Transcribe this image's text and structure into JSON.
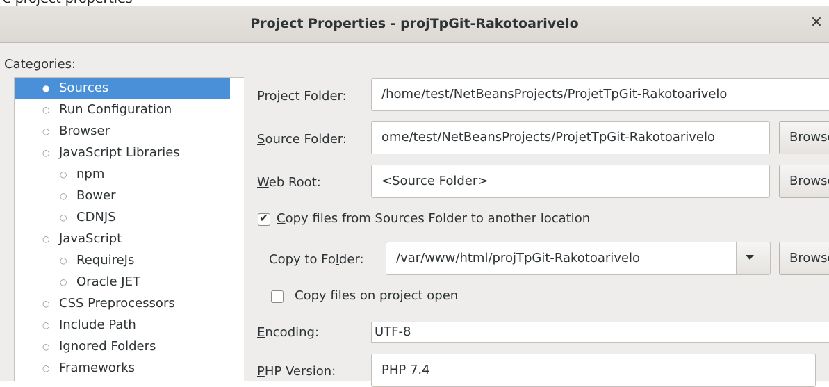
{
  "window": {
    "top_strip_text": "e project properties",
    "title": "Project Properties - projTpGit-Rakotoarivelo",
    "close_glyph": "×"
  },
  "categories": {
    "label_mnemonic": "C",
    "label_rest": "ategories:",
    "items": [
      {
        "label": "Sources",
        "level": 1,
        "selected": true,
        "expander": ""
      },
      {
        "label": "Run Configuration",
        "level": 1,
        "selected": false,
        "expander": ""
      },
      {
        "label": "Browser",
        "level": 1,
        "selected": false,
        "expander": ""
      },
      {
        "label": "JavaScript Libraries",
        "level": 1,
        "selected": false,
        "expander": "▼"
      },
      {
        "label": "npm",
        "level": 2,
        "selected": false,
        "expander": ""
      },
      {
        "label": "Bower",
        "level": 2,
        "selected": false,
        "expander": ""
      },
      {
        "label": "CDNJS",
        "level": 2,
        "selected": false,
        "expander": ""
      },
      {
        "label": "JavaScript",
        "level": 1,
        "selected": false,
        "expander": "▼"
      },
      {
        "label": "RequireJs",
        "level": 2,
        "selected": false,
        "expander": ""
      },
      {
        "label": "Oracle JET",
        "level": 2,
        "selected": false,
        "expander": ""
      },
      {
        "label": "CSS Preprocessors",
        "level": 1,
        "selected": false,
        "expander": ""
      },
      {
        "label": "Include Path",
        "level": 1,
        "selected": false,
        "expander": ""
      },
      {
        "label": "Ignored Folders",
        "level": 1,
        "selected": false,
        "expander": ""
      },
      {
        "label": "Frameworks",
        "level": 1,
        "selected": false,
        "expander": "▼"
      }
    ]
  },
  "sources": {
    "project_folder": {
      "label_pre": "Project F",
      "label_mn": "o",
      "label_post": "lder:",
      "value": "/home/test/NetBeansProjects/ProjetTpGit-Rakotoarivelo"
    },
    "source_folder": {
      "label_pre": "",
      "label_mn": "S",
      "label_post": "ource Folder:",
      "value": "ome/test/NetBeansProjects/ProjetTpGit-Rakotoarivelo",
      "browse_pre": "",
      "browse_mn": "B",
      "browse_post": "rowse..."
    },
    "web_root": {
      "label_pre": "",
      "label_mn": "W",
      "label_post": "eb Root:",
      "value": "<Source Folder>",
      "browse_pre": "B",
      "browse_mn": "r",
      "browse_post": "owse..."
    },
    "copy_files": {
      "checked": true,
      "label_pre": "",
      "label_mn": "C",
      "label_post": "opy files from Sources Folder to another location"
    },
    "copy_to_folder": {
      "label_pre": "Copy to Fo",
      "label_mn": "l",
      "label_post": "der:",
      "value": "/var/www/html/projTpGit-Rakotoarivelo",
      "browse_pre": "B",
      "browse_mn": "r",
      "browse_post": "owse..."
    },
    "copy_on_open": {
      "checked": false,
      "label_pre": "Copy files on pro",
      "label_mn": "j",
      "label_post": "ect open"
    },
    "encoding": {
      "label_pre": "",
      "label_mn": "E",
      "label_post": "ncoding:",
      "value": "UTF-8"
    },
    "php_version": {
      "label_pre": "",
      "label_mn": "P",
      "label_post": "HP Version:",
      "value": "PHP 7.4"
    }
  }
}
